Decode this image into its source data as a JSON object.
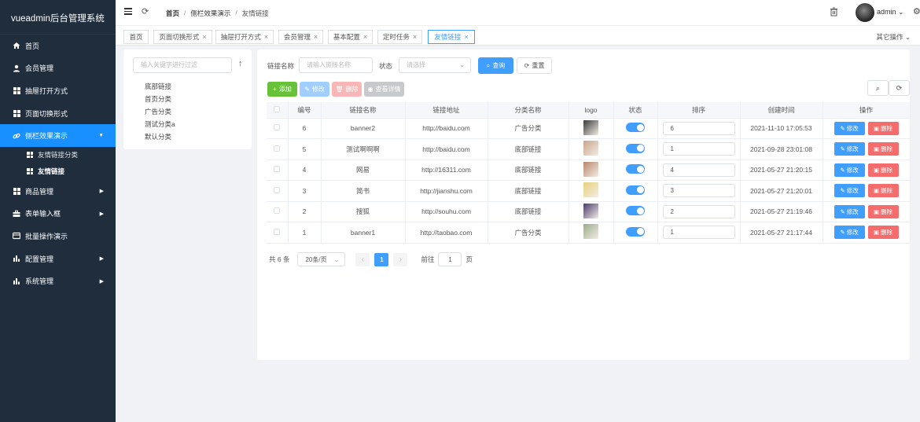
{
  "app": {
    "title": "vueadmin后台管理系统"
  },
  "sidebar": {
    "items": [
      {
        "label": "首页",
        "icon": "home-icon",
        "active": false,
        "arrow": false
      },
      {
        "label": "会员管理",
        "icon": "user-icon",
        "active": false,
        "arrow": false
      },
      {
        "label": "抽屉打开方式",
        "icon": "grid-icon",
        "active": false,
        "arrow": false
      },
      {
        "label": "页面切换形式",
        "icon": "grid-icon",
        "active": false,
        "arrow": false
      },
      {
        "label": "侧栏效果演示",
        "icon": "link-icon",
        "active": true,
        "arrow": true
      }
    ],
    "sub_items": [
      {
        "label": "友情链接分类",
        "active": false
      },
      {
        "label": "友情链接",
        "active": true
      }
    ],
    "items_after": [
      {
        "label": "商品管理",
        "icon": "grid-icon",
        "arrow": true
      },
      {
        "label": "表单输入框",
        "icon": "briefcase-icon",
        "arrow": true
      },
      {
        "label": "批量操作演示",
        "icon": "card-icon",
        "arrow": false
      },
      {
        "label": "配置管理",
        "icon": "bar-chart-icon",
        "arrow": true
      },
      {
        "label": "系统管理",
        "icon": "bar-chart-icon",
        "arrow": true
      }
    ]
  },
  "header": {
    "breadcrumb": [
      "首页",
      "侧栏效果演示",
      "友情链接"
    ],
    "breadcrumb_sep": "/",
    "user": "admin"
  },
  "tabs": [
    {
      "label": "首页",
      "closable": false,
      "active": false
    },
    {
      "label": "页面切换形式",
      "closable": true,
      "active": false
    },
    {
      "label": "抽屉打开方式",
      "closable": true,
      "active": false
    },
    {
      "label": "会员管理",
      "closable": true,
      "active": false
    },
    {
      "label": "基本配置",
      "closable": true,
      "active": false
    },
    {
      "label": "定时任务",
      "closable": true,
      "active": false
    },
    {
      "label": "友情链接",
      "closable": true,
      "active": true
    }
  ],
  "tabs_other_ops": "其它操作",
  "tree": {
    "filter_placeholder": "输入关键字进行过滤",
    "nodes": [
      "底部链接",
      "首页分类",
      "广告分类",
      "测试分类a",
      "默认分类"
    ]
  },
  "search": {
    "name_label": "链接名称",
    "name_placeholder": "请输入链接名称",
    "status_label": "状态",
    "status_placeholder": "请选择",
    "query_button": "查询",
    "reset_button": "重置"
  },
  "toolbar": {
    "add": "添加",
    "edit": "修改",
    "delete": "删除",
    "view": "查看详情"
  },
  "table": {
    "columns": [
      "编号",
      "链接名称",
      "链接地址",
      "分类名称",
      "logo",
      "状态",
      "排序",
      "创建时间",
      "操作"
    ],
    "rows": [
      {
        "id": "6",
        "name": "banner2",
        "url": "http://baidu.com",
        "category": "广告分类",
        "sort": "6",
        "created": "2021-11-10 17:05:53",
        "logo_color": "#3a3a3a"
      },
      {
        "id": "5",
        "name": "测试啊啊啊",
        "url": "http://baidu.com",
        "category": "底部链接",
        "sort": "1",
        "created": "2021-09-28 23:01:08",
        "logo_color": "#c9a58a"
      },
      {
        "id": "4",
        "name": "网易",
        "url": "http://16311.com",
        "category": "底部链接",
        "sort": "4",
        "created": "2021-05-27 21:20:15",
        "logo_color": "#b9866a"
      },
      {
        "id": "3",
        "name": "简书",
        "url": "http://jianshu.com",
        "category": "底部链接",
        "sort": "3",
        "created": "2021-05-27 21:20:01",
        "logo_color": "#e8d27a"
      },
      {
        "id": "2",
        "name": "搜狐",
        "url": "http://souhu.com",
        "category": "底部链接",
        "sort": "2",
        "created": "2021-05-27 21:19:46",
        "logo_color": "#4a3a6a"
      },
      {
        "id": "1",
        "name": "banner1",
        "url": "http://taobao.com",
        "category": "广告分类",
        "sort": "1",
        "created": "2021-05-27 21:17:44",
        "logo_color": "#9aab8a"
      }
    ],
    "edit_label": "修改",
    "delete_label": "删除"
  },
  "pager": {
    "total": "共 6 条",
    "page_size": "20条/页",
    "current": "1",
    "goto_prefix": "前往",
    "goto_value": "1",
    "goto_suffix": "页"
  },
  "colors": {
    "sidebar_bg": "#1f2d3d",
    "accent": "#409eff",
    "active_menu": "#1890ff",
    "danger": "#f56c6c",
    "success": "#67c23a"
  }
}
